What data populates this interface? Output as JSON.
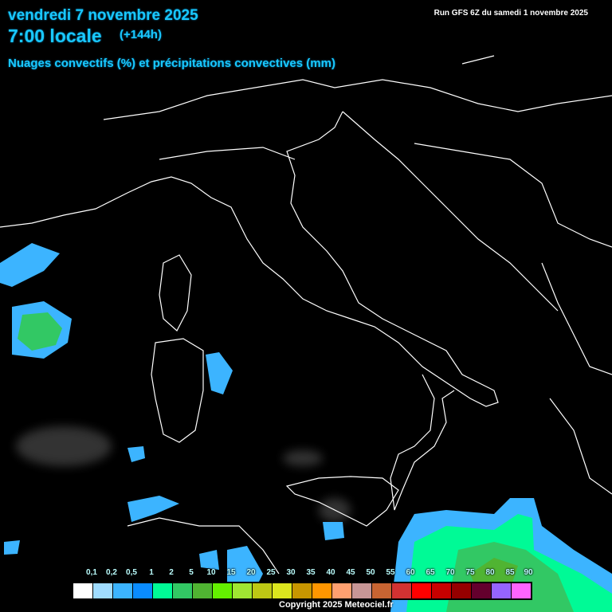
{
  "header": {
    "date": "vendredi 7 novembre 2025",
    "time": "7:00 locale",
    "lead": "(+144h)",
    "parameter": "Nuages convectifs (%) et précipitations convectives (mm)",
    "run": "Run GFS 6Z du samedi 1 novembre 2025"
  },
  "legend": {
    "labels": [
      "0,1",
      "0,2",
      "0,5",
      "1",
      "2",
      "5",
      "10",
      "15",
      "20",
      "25",
      "30",
      "35",
      "40",
      "45",
      "50",
      "55",
      "60",
      "65",
      "70",
      "75",
      "80",
      "85",
      "90"
    ],
    "colors": [
      "#ffffff",
      "#a0dcff",
      "#3cb4ff",
      "#0a8cff",
      "#00fa96",
      "#32c864",
      "#50b432",
      "#64f000",
      "#a0e632",
      "#bec814",
      "#dce61e",
      "#c89600",
      "#ff9600",
      "#ffa070",
      "#c89696",
      "#c86432",
      "#d23232",
      "#ff0000",
      "#c80000",
      "#960000",
      "#64002d",
      "#9664ff",
      "#ff64ff"
    ]
  },
  "footer": {
    "copyright": "Copyright 2025 Meteociel.fr"
  }
}
